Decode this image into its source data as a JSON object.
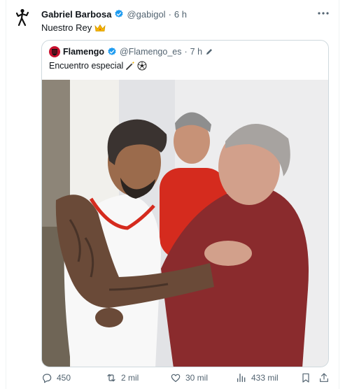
{
  "tweet": {
    "author_name": "Gabriel Barbosa",
    "author_handle": "@gabigol",
    "separator": "·",
    "time": "6 h",
    "text": "Nuestro Rey",
    "emoji": "crown-emoji"
  },
  "quote": {
    "author_name": "Flamengo",
    "author_handle": "@Flamengo_es",
    "separator": "·",
    "time": "7 h",
    "text": "Encuentro especial",
    "emojis": [
      "magic-wand-emoji",
      "soccer-ball-emoji"
    ],
    "photo_alt": "Photo of two men embracing"
  },
  "actions": {
    "replies": "450",
    "reposts": "2 mil",
    "likes": "30 mil",
    "views": "433 mil"
  },
  "colors": {
    "verified": "#1d9bf0",
    "muted": "#536471",
    "flamengo_red": "#c8102e",
    "border": "#cfd9de"
  },
  "icons": [
    "runner-avatar-icon",
    "verified-badge-icon",
    "more-icon",
    "edited-pencil-icon",
    "reply-icon",
    "repost-icon",
    "like-icon",
    "views-icon",
    "bookmark-icon",
    "share-icon"
  ]
}
